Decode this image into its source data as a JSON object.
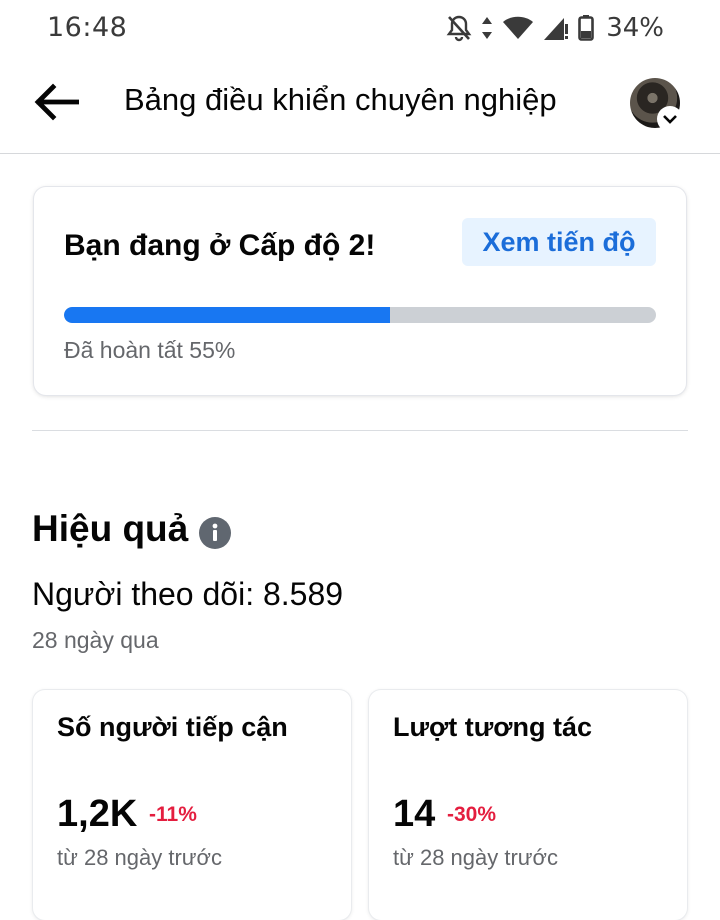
{
  "status_bar": {
    "time": "16:48",
    "battery": "34%",
    "icons": [
      "bell-off-icon",
      "data-arrows-icon",
      "wifi-icon",
      "signal-icon",
      "battery-icon"
    ]
  },
  "header": {
    "title": "Bảng điều khiển chuyên nghiệp",
    "back_icon": "arrow-left-icon",
    "avatar_badge_icon": "chevron-down-icon"
  },
  "level_card": {
    "title": "Bạn đang ở Cấp độ 2!",
    "progress_button": "Xem tiến độ",
    "progress_value": 0.55,
    "progress_label": "Đã hoàn tất 55%"
  },
  "performance": {
    "heading": "Hiệu quả",
    "info_icon": "info-icon",
    "followers": "Người theo dõi: 8.589",
    "period": "28 ngày qua",
    "cards": [
      {
        "title": "Số người tiếp cận",
        "value": "1,2K",
        "change": "-11%",
        "sub": "từ 28 ngày trước"
      },
      {
        "title": "Lượt tương tác",
        "value": "14",
        "change": "-30%",
        "sub": "từ 28 ngày trước"
      }
    ]
  },
  "colors": {
    "accent": "#1877f2",
    "link": "#1b6dd9",
    "link_bg": "#e7f3ff",
    "negative": "#e41e3f",
    "secondary_text": "#65676b"
  }
}
